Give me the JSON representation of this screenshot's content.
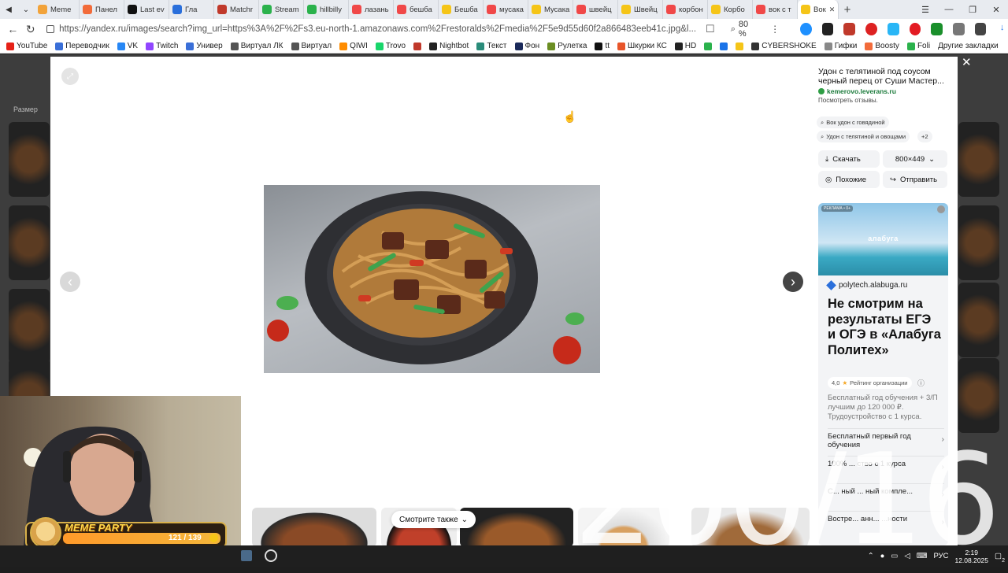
{
  "browser": {
    "tabs": [
      {
        "label": "Meme",
        "color": "#f2a33a"
      },
      {
        "label": "Панел",
        "color": "#f26b3a"
      },
      {
        "label": "Last ev",
        "color": "#111111"
      },
      {
        "label": "Гла",
        "color": "#2a6fdb"
      },
      {
        "label": "Matchr",
        "color": "#c0392b"
      },
      {
        "label": "Stream",
        "color": "#2bb24c"
      },
      {
        "label": "hillbilly",
        "color": "#2bb24c"
      },
      {
        "label": "лазань",
        "color": "#f04848"
      },
      {
        "label": "бешба",
        "color": "#f04848"
      },
      {
        "label": "Бешба",
        "color": "#f5c518"
      },
      {
        "label": "мусака",
        "color": "#f04848"
      },
      {
        "label": "Мусака",
        "color": "#f5c518"
      },
      {
        "label": "швейц",
        "color": "#f04848"
      },
      {
        "label": "Швейц",
        "color": "#f5c518"
      },
      {
        "label": "корбон",
        "color": "#f04848"
      },
      {
        "label": "Корбо",
        "color": "#f5c518"
      },
      {
        "label": "вок с т",
        "color": "#f04848"
      }
    ],
    "active_tab": {
      "label": "Вок",
      "color": "#f5c518"
    },
    "url": "https://yandex.ru/images/search?img_url=https%3A%2F%2Fs3.eu-north-1.amazonaws.com%2Frestoralds%2Fmedia%2F5e9d55d60f2a866483eeb41c.jpg&l...",
    "zoom": "80 %",
    "bookmarks": [
      {
        "label": "YouTube",
        "color": "#e62117"
      },
      {
        "label": "Переводчик",
        "color": "#3a6fd8"
      },
      {
        "label": "VK",
        "color": "#2787f5"
      },
      {
        "label": "Twitch",
        "color": "#9146ff"
      },
      {
        "label": "Универ",
        "color": "#3a6fd8"
      },
      {
        "label": "Виртуал ЛК",
        "color": "#555555"
      },
      {
        "label": "Виртуал",
        "color": "#555555"
      },
      {
        "label": "QIWI",
        "color": "#ff8c00"
      },
      {
        "label": "Trovo",
        "color": "#19d66b"
      },
      {
        "label": "",
        "color": "#c0392b"
      },
      {
        "label": "Nightbot",
        "color": "#222222"
      },
      {
        "label": "Текст",
        "color": "#2a8c7a"
      },
      {
        "label": "Фон",
        "color": "#1a2a5a"
      },
      {
        "label": "Рулетка",
        "color": "#6b8e23"
      },
      {
        "label": "tt",
        "color": "#111111"
      },
      {
        "label": "Шкурки КС",
        "color": "#e8552a"
      },
      {
        "label": "HD",
        "color": "#222222"
      },
      {
        "label": "",
        "color": "#2bb24c"
      },
      {
        "label": "",
        "color": "#1a73e8"
      },
      {
        "label": "",
        "color": "#f5c518"
      },
      {
        "label": "CYBERSHOKE",
        "color": "#333333"
      },
      {
        "label": "Гифки",
        "color": "#888888"
      },
      {
        "label": "Boosty",
        "color": "#f26b3a"
      },
      {
        "label": "Foli",
        "color": "#2bb24c"
      }
    ],
    "bookmarks_other": "Другие закладки",
    "window_controls": [
      "—",
      "❐",
      "✕"
    ]
  },
  "page": {
    "size_label": "Размер"
  },
  "viewer": {
    "see_also": "Смотрите также",
    "overlay_text": "200/16"
  },
  "sidebar": {
    "title": "Удон с телятиной под соусом черный перец от Суши Мастер...",
    "source": "kemerovo.leverans.ru",
    "reviews": "Посмотреть отзывы.",
    "chips": [
      "Вок удон с говядиной",
      "Удон с телятиной и овощами",
      "+2"
    ],
    "download": "Скачать",
    "size": "800×449",
    "similar": "Похожие",
    "share": "Отправить"
  },
  "ad": {
    "tag": "РЕКЛАМА • 0+",
    "brand": "алабуга",
    "domain": "polytech.alabuga.ru",
    "headline": "Не смотрим на результаты ЕГЭ и ОГЭ в «Алабуга Политех»",
    "rating_value": "4,0",
    "rating_label": "Рейтинг организации",
    "description": "Бесплатный год обучения + 3/П лучшим до 120 000 ₽. Трудоустройство с 1 курса.",
    "items": [
      "Бесплатный первый год обучения",
      "100% ... ство с 1 курса",
      "С... ный ... ный компле...",
      "Востре... анн... ...ности"
    ]
  },
  "overlay": {
    "title": "MEME PARTY",
    "count": "121 / 139"
  },
  "taskbar": {
    "lang": "РУС",
    "time": "2:19",
    "date": "12.08.2025",
    "notif_count": "2"
  }
}
